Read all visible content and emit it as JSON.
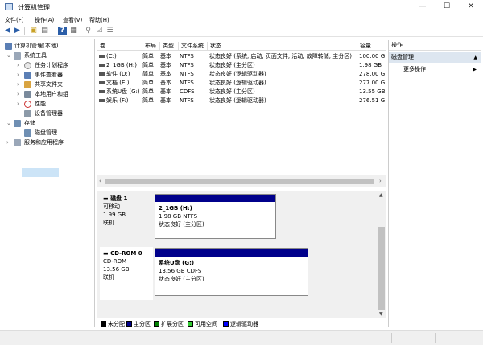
{
  "window": {
    "title": "计算机管理",
    "minimize": "—",
    "maximize": "☐",
    "close": "✕"
  },
  "menu": [
    "文件(F)",
    "操作(A)",
    "查看(V)",
    "帮助(H)"
  ],
  "tree": {
    "root": "计算机管理(本地)",
    "system_tools": "系统工具",
    "task_scheduler": "任务计划程序",
    "event_viewer": "事件查看器",
    "shared_folders": "共享文件夹",
    "local_users": "本地用户和组",
    "performance": "性能",
    "device_manager": "设备管理器",
    "storage": "存储",
    "disk_management": "磁盘管理",
    "services_apps": "服务和应用程序"
  },
  "volumes": {
    "headers": [
      "卷",
      "布局",
      "类型",
      "文件系统",
      "状态",
      "容量"
    ],
    "rows": [
      {
        "name": "(C:)",
        "layout": "简单",
        "type": "基本",
        "fs": "NTFS",
        "status": "状态良好 (系统, 启动, 页面文件, 活动, 故障转储, 主分区)",
        "capacity": "100.00 G"
      },
      {
        "name": "2_1GB (H:)",
        "layout": "简单",
        "type": "基本",
        "fs": "NTFS",
        "status": "状态良好 (主分区)",
        "capacity": "1.98 GB"
      },
      {
        "name": "软件 (D:)",
        "layout": "简单",
        "type": "基本",
        "fs": "NTFS",
        "status": "状态良好 (逻辑驱动器)",
        "capacity": "278.00 G"
      },
      {
        "name": "文档 (E:)",
        "layout": "简单",
        "type": "基本",
        "fs": "NTFS",
        "status": "状态良好 (逻辑驱动器)",
        "capacity": "277.00 G"
      },
      {
        "name": "系统U盘 (G:)",
        "layout": "简单",
        "type": "基本",
        "fs": "CDFS",
        "status": "状态良好 (主分区)",
        "capacity": "13.55 GB"
      },
      {
        "name": "娱乐 (F:)",
        "layout": "简单",
        "type": "基本",
        "fs": "NTFS",
        "status": "状态良好 (逻辑驱动器)",
        "capacity": "276.51 G"
      }
    ]
  },
  "disks": [
    {
      "name": "磁盘 1",
      "kind": "可移动",
      "size": "1.99 GB",
      "state": "联机",
      "partition": {
        "label": "2_1GB  (H:)",
        "size": "1.98 GB NTFS",
        "status": "状态良好 (主分区)"
      }
    },
    {
      "name": "CD-ROM 0",
      "kind": "CD-ROM",
      "size": "13.56 GB",
      "state": "联机",
      "partition": {
        "label": "系统U盘  (G:)",
        "size": "13.56 GB CDFS",
        "status": "状态良好 (主分区)"
      }
    }
  ],
  "legend": [
    {
      "label": "未分配",
      "color": "#000000"
    },
    {
      "label": "主分区",
      "color": "#00008b"
    },
    {
      "label": "扩展分区",
      "color": "#008000"
    },
    {
      "label": "可用空间",
      "color": "#33cc33"
    },
    {
      "label": "逻辑驱动器",
      "color": "#0000ff"
    }
  ],
  "actions": {
    "header": "操作",
    "section": "磁盘管理",
    "more": "更多操作"
  }
}
